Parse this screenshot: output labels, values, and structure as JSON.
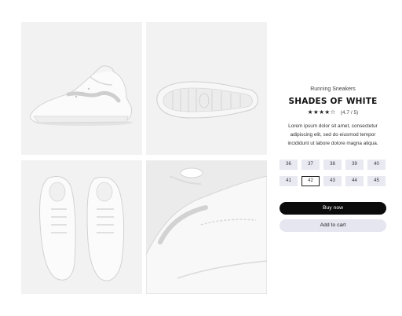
{
  "product": {
    "category": "Running Sneakers",
    "title": "SHADES OF WHITE",
    "stars": "★★★★☆",
    "rating_text": "(4.7 / 5)",
    "description": "Lorem ipsum dolor sit amet, consectetur adipiscing elit, sed do eiusmod tempor incididunt ut labore dolore magna aliqua."
  },
  "gallery": {
    "images": [
      "sneaker-side-view",
      "sneaker-sole-view",
      "sneaker-pair-top-view",
      "sneaker-closeup-view"
    ]
  },
  "sizes": {
    "options": [
      "36",
      "37",
      "38",
      "39",
      "40",
      "41",
      "42",
      "43",
      "44",
      "45"
    ],
    "selected": "42"
  },
  "actions": {
    "buy_now": "Buy now",
    "add_to_cart": "Add to cart"
  },
  "colors": {
    "primary_button": "#0b0b0b",
    "secondary_button": "#e5e6ef",
    "size_chip": "#e8e9f1"
  }
}
